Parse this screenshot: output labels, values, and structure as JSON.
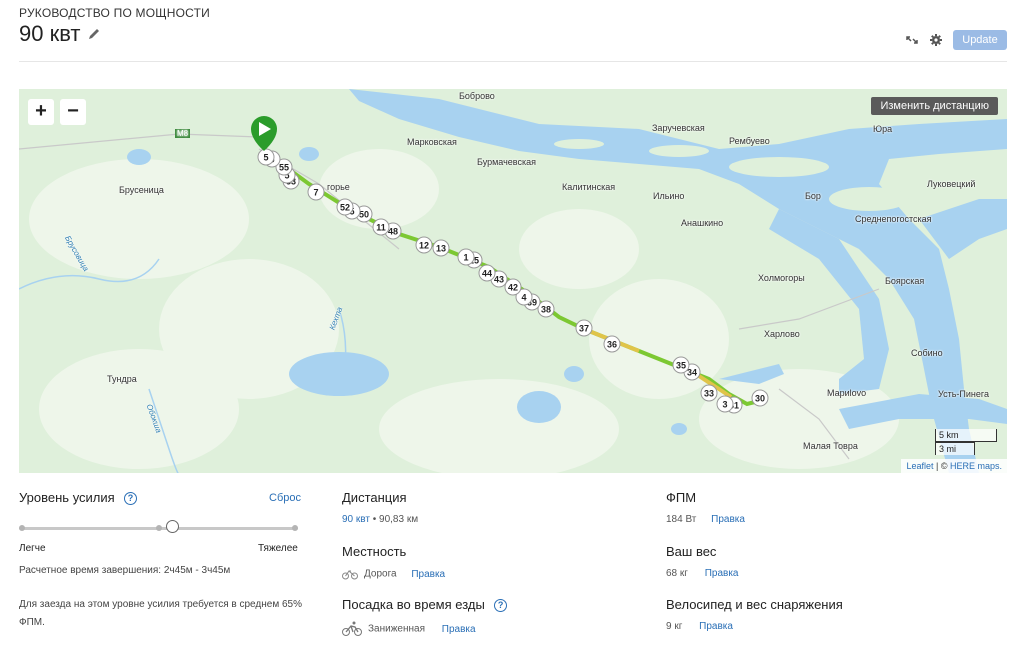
{
  "header": {
    "subtitle": "РУКОВОДСТВО ПО МОЩНОСТИ",
    "title": "90 квт",
    "update_label": "Update",
    "icons": [
      "pencil-icon",
      "expand-icon",
      "gear-icon"
    ]
  },
  "map": {
    "zoom_in": "+",
    "zoom_out": "−",
    "change_distance": "Изменить дистанцию",
    "places": [
      "Боброво",
      "Заручевская",
      "Юра",
      "Рембуево",
      "Марковская",
      "Бурмачевская",
      "Калитинская",
      "Луковецкий",
      "Бор",
      "Брусеница",
      "Ильино",
      "Среднепогостская",
      "Анашкино",
      "Холмогоры",
      "Боярская",
      "Харлово",
      "Собино",
      "Мариlovo",
      "Усть-Пинега",
      "Малая Товра",
      "Тундра",
      "горье",
      "М8",
      "Брусовица",
      "Кехта",
      "Обокша"
    ],
    "markers": [
      "5",
      "5",
      "55",
      "5",
      "53",
      "7",
      "52",
      "5",
      "50",
      "11",
      "48",
      "12",
      "13",
      "1",
      "15",
      "44",
      "43",
      "42",
      "4",
      "39",
      "38",
      "37",
      "36",
      "35",
      "34",
      "33",
      "3",
      "31",
      "30"
    ],
    "scale_km": "5 km",
    "scale_mi": "3 mi",
    "attribution_leaflet": "Leaflet",
    "attribution_sep": " | © ",
    "attribution_here": "HERE maps."
  },
  "effort": {
    "label": "Уровень усилия",
    "reset": "Сброс",
    "easier": "Легче",
    "harder": "Тяжелее",
    "slider_level": 0.55,
    "estimate": "Расчетное время завершения: 2ч45м - 3ч45м",
    "note": "Для заезда на этом уровне усилия требуется в среднем 65% ФПМ."
  },
  "distance": {
    "label": "Дистанция",
    "value_link": "90 квт",
    "sep": " • ",
    "km": "90,83 км"
  },
  "terrain": {
    "label": "Местность",
    "value": "Дорога",
    "edit": "Правка"
  },
  "position": {
    "label": "Посадка во время езды",
    "value": "Заниженная",
    "edit": "Правка"
  },
  "ftp": {
    "label": "ФПМ",
    "value": "184 Вт",
    "edit": "Правка"
  },
  "weight": {
    "label": "Ваш вес",
    "value": "68 кг",
    "edit": "Правка"
  },
  "bike": {
    "label": "Велосипед и вес снаряжения",
    "value": "9 кг",
    "edit": "Правка"
  }
}
